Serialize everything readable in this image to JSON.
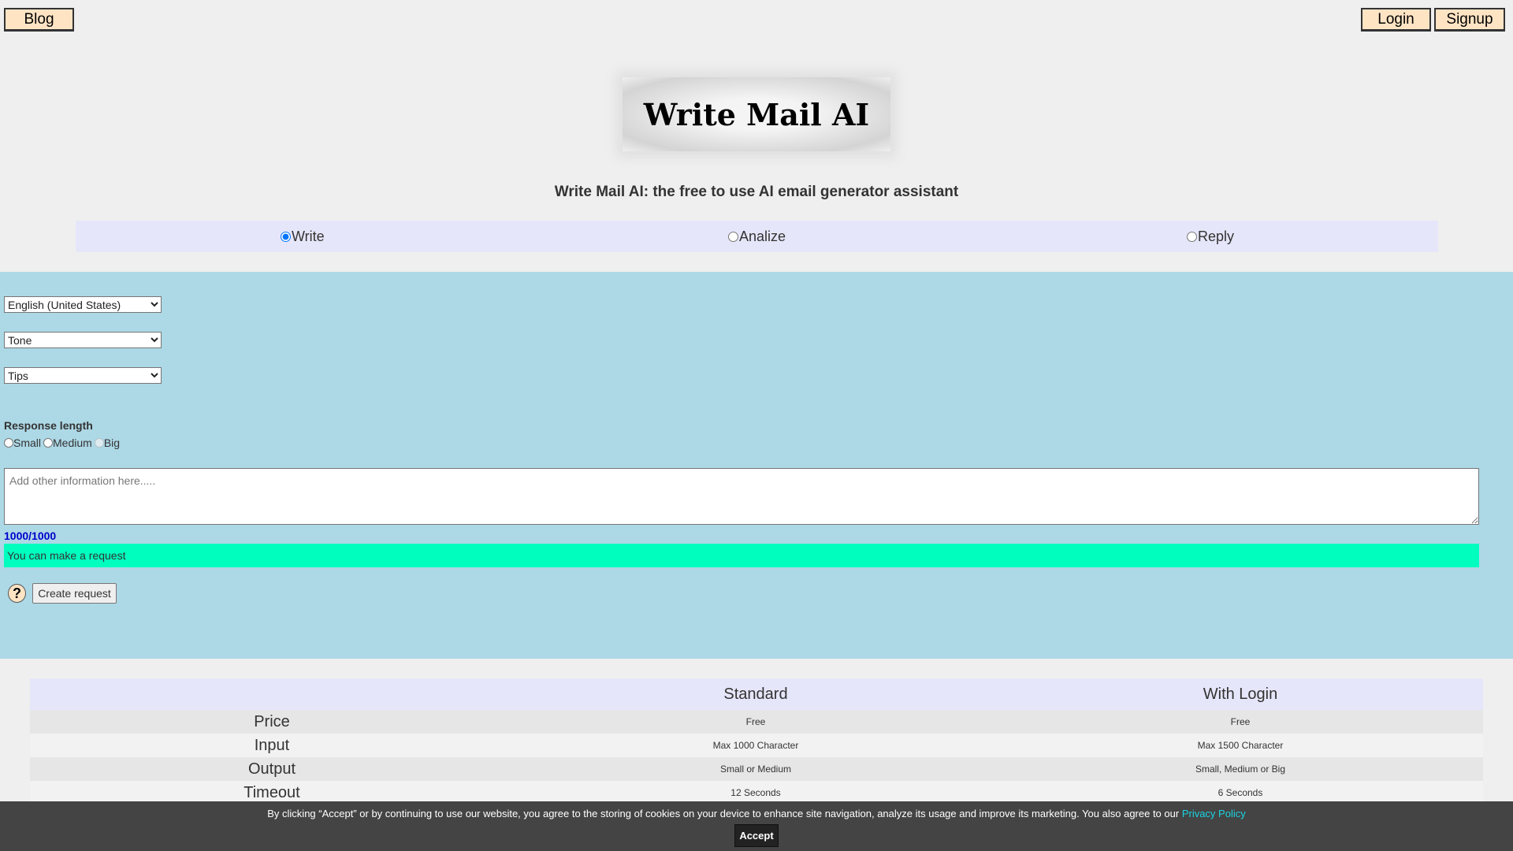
{
  "nav": {
    "blog": "Blog",
    "login": "Login",
    "signup": "Signup"
  },
  "logo": {
    "title": "Write Mail AI"
  },
  "subtitle": "Write Mail AI: the free to use AI email generator assistant",
  "modes": [
    {
      "label": "Write",
      "checked": true
    },
    {
      "label": "Analize",
      "checked": false
    },
    {
      "label": "Reply",
      "checked": false
    }
  ],
  "form": {
    "language": "English (United States)",
    "tone": "Tone",
    "tips": "Tips",
    "response_length_label": "Response length",
    "response_lengths": [
      "Small",
      "Medium",
      "Big"
    ],
    "textarea_placeholder": "Add other information here.....",
    "counter": "1000/1000",
    "status": "You can make a request",
    "help_icon": "?",
    "create_button": "Create request",
    "status_color": "#00ffbf"
  },
  "table": {
    "headers": [
      "",
      "Standard",
      "With Login"
    ],
    "rows": [
      [
        "Price",
        "Free",
        "Free"
      ],
      [
        "Input",
        "Max 1000 Character",
        "Max 1500 Character"
      ],
      [
        "Output",
        "Small or Medium",
        "Small, Medium or Big"
      ],
      [
        "Timeout",
        "12 Seconds",
        "6 Seconds"
      ]
    ]
  },
  "cookie": {
    "text": "By clicking “Accept” or by continuing to use our website, you agree to the storing of cookies on your device to enhance site navigation, analyze its usage and improve its marketing. You also agree to our ",
    "link": "Privacy Policy",
    "accept": "Accept"
  }
}
